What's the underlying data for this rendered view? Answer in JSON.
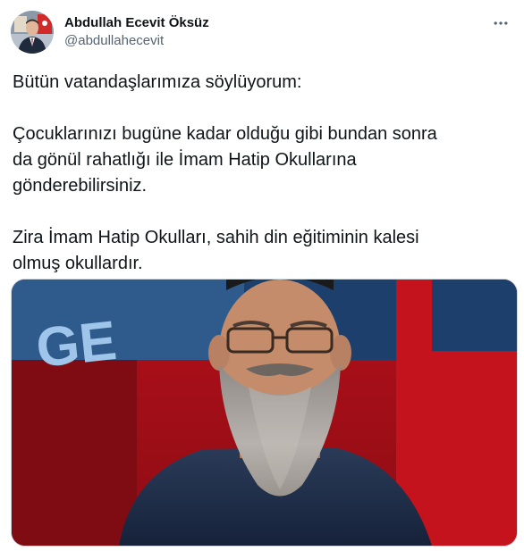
{
  "tweet": {
    "author": {
      "display_name": "Abdullah Ecevit Öksüz",
      "handle": "@abdullahecevit"
    },
    "more_icon": "more-horizontal-icon",
    "paragraphs": [
      "Bütün vatandaşlarımıza söylüyorum:",
      "Çocuklarınızı bugüne kadar olduğu gibi bundan sonra\nda gönül rahatlığı ile İmam Hatip Okullarına\ngönderebilirsiniz.",
      "Zira İmam Hatip Okulları, sahih din eğitiminin kalesi\nolmuş okullardır."
    ],
    "media": {
      "overlay_text": "GE"
    }
  },
  "colors": {
    "text_primary": "#0f1419",
    "text_secondary": "#536471",
    "border": "#cfd9de",
    "media_bg_red": "#c4131c",
    "media_bg_blue": "#1c3f6e"
  }
}
